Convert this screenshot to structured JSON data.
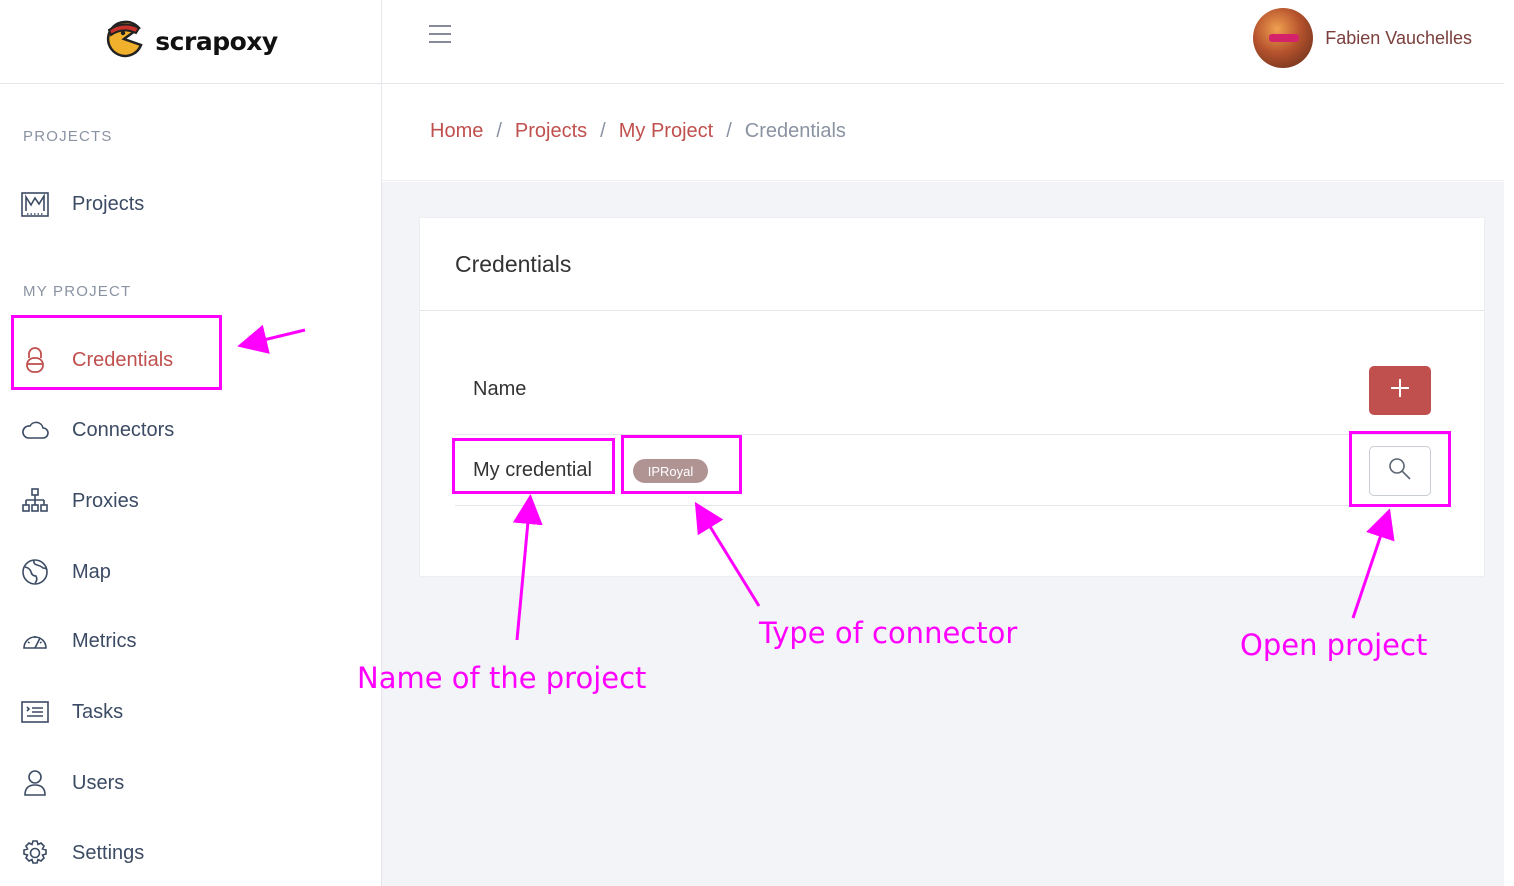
{
  "brand": {
    "name": "scrapoxy"
  },
  "header": {
    "menu_icon": "hamburger-icon",
    "user_name": "Fabien Vauchelles"
  },
  "sidebar": {
    "section_projects": "PROJECTS",
    "section_my_project": "MY PROJECT",
    "items": [
      {
        "label": "Projects",
        "icon": "chart-icon"
      },
      {
        "label": "Credentials",
        "icon": "lock-icon",
        "active": true
      },
      {
        "label": "Connectors",
        "icon": "cloud-icon"
      },
      {
        "label": "Proxies",
        "icon": "hierarchy-icon"
      },
      {
        "label": "Map",
        "icon": "globe-icon"
      },
      {
        "label": "Metrics",
        "icon": "speedometer-icon"
      },
      {
        "label": "Tasks",
        "icon": "list-icon"
      },
      {
        "label": "Users",
        "icon": "user-icon"
      },
      {
        "label": "Settings",
        "icon": "gear-icon"
      }
    ]
  },
  "breadcrumb": {
    "items": [
      "Home",
      "Projects",
      "My Project"
    ],
    "current": "Credentials",
    "separator": "/"
  },
  "card": {
    "title": "Credentials",
    "column_name": "Name",
    "add_label": "+",
    "rows": [
      {
        "name": "My credential",
        "type": "IPRoyal"
      }
    ]
  },
  "annotations": {
    "name_of_project": "Name of the project",
    "type_of_connector": "Type of connector",
    "open_project": "Open project"
  },
  "colors": {
    "accent": "#c0504d",
    "annotation": "#ff00ff",
    "badge": "#b09494",
    "muted": "#8a93a2"
  }
}
